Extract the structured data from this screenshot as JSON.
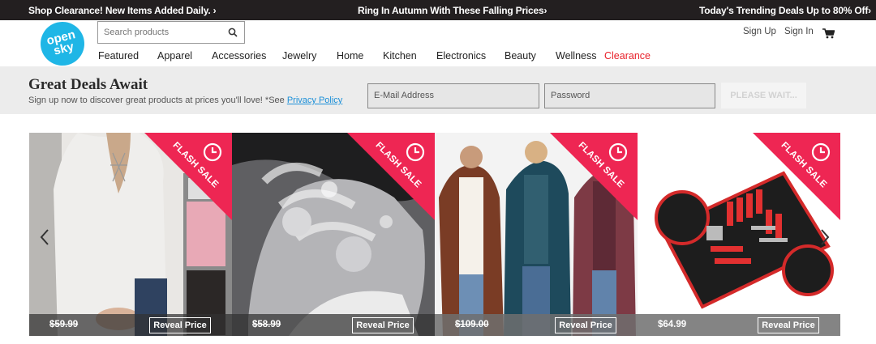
{
  "promo": {
    "left": "Shop Clearance! New Items Added Daily. ›",
    "center": "Ring In Autumn With These Falling Prices›",
    "right": "Today's Trending Deals Up to 80% Off›"
  },
  "logo": {
    "line1": "open",
    "line2": "sky"
  },
  "search": {
    "placeholder": "Search products"
  },
  "account": {
    "signup": "Sign Up",
    "signin": "Sign In"
  },
  "nav": {
    "items": [
      "Featured",
      "Apparel",
      "Accessories",
      "Jewelry",
      "Home",
      "Kitchen",
      "Electronics",
      "Beauty",
      "Wellness"
    ],
    "clearance": "Clearance"
  },
  "signup_band": {
    "title": "Great Deals Await",
    "subtitle": "Sign up now to discover great products at prices you'll love! *See ",
    "privacy_link": "Privacy Policy",
    "email_placeholder": "E-Mail Address",
    "password_placeholder": "Password",
    "button": "PLEASE WAIT..."
  },
  "products": [
    {
      "badge": "FLASH SALE",
      "price": "$59.99",
      "reveal": "Reveal Price"
    },
    {
      "badge": "FLASH SALE",
      "price": "$58.99",
      "reveal": "Reveal Price"
    },
    {
      "badge": "FLASH SALE",
      "price": "$109.00",
      "reveal": "Reveal Price"
    },
    {
      "badge": "FLASH SALE",
      "price": "$64.99",
      "reveal": "Reveal Price"
    }
  ],
  "colors": {
    "promo_bg": "#231f20",
    "logo": "#1fb6e6",
    "clearance": "#e8202a",
    "ribbon": "#ee2653",
    "link": "#1a8fd8"
  }
}
